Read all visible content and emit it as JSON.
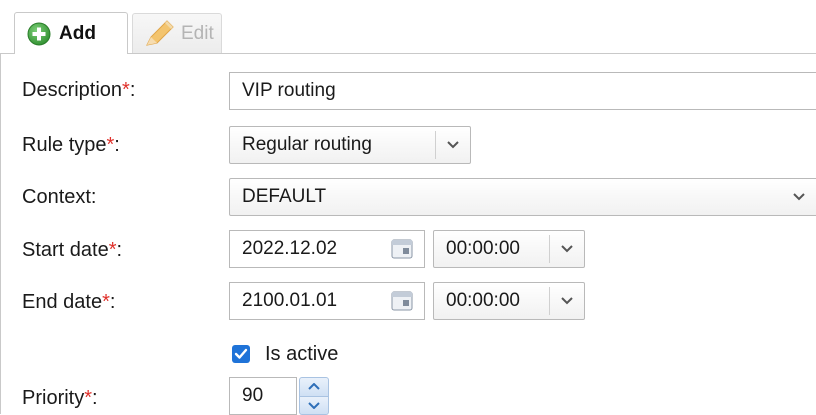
{
  "tabs": {
    "add": {
      "label": "Add",
      "icon": "plus-circle-icon",
      "active": true
    },
    "edit": {
      "label": "Edit",
      "icon": "pencil-icon",
      "active": false
    }
  },
  "form": {
    "description": {
      "label": "Description",
      "required_mark": "*",
      "colon": ":",
      "value": "VIP routing"
    },
    "rule_type": {
      "label": "Rule type",
      "required_mark": "*",
      "colon": ":",
      "value": "Regular routing"
    },
    "context": {
      "label": "Context:",
      "value": "DEFAULT"
    },
    "start_date": {
      "label": "Start date",
      "required_mark": "*",
      "colon": ":",
      "date": "2022.12.02",
      "time": "00:00:00"
    },
    "end_date": {
      "label": "End date",
      "required_mark": "*",
      "colon": ":",
      "date": "2100.01.01",
      "time": "00:00:00"
    },
    "is_active": {
      "label": "Is active",
      "checked": true
    },
    "priority": {
      "label": "Priority",
      "required_mark": "*",
      "colon": ":",
      "value": "90"
    }
  },
  "colors": {
    "required": "#e0302a",
    "checkbox": "#1f73d8",
    "add_icon": "#3aa13a",
    "edit_icon": "#f0b850"
  }
}
